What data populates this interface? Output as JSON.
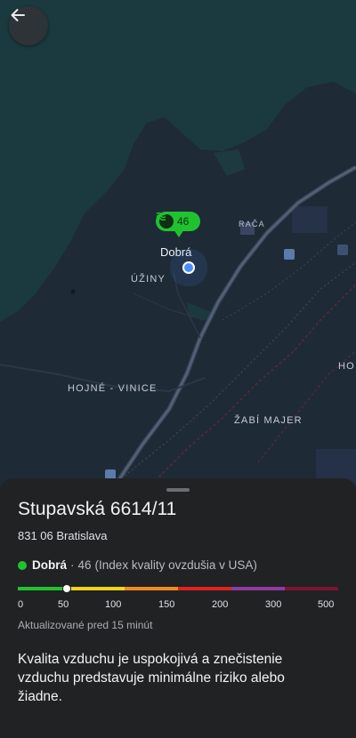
{
  "map": {
    "labels": {
      "uziny": "ÚŽINY",
      "raca": "RAČA",
      "hojne_vinice": "HOJNÉ - VINICE",
      "zabi_majer": "ŽABÍ MAJER",
      "edge": "HO"
    },
    "pin": {
      "value": "46",
      "icon": "air-quality-waves-icon",
      "color": "#1fc32e"
    },
    "pin_label": "Dobrá",
    "current_location_color": "#4a8df8"
  },
  "sheet": {
    "title": "Stupavská 6614/11",
    "subtitle": "831 06 Bratislava",
    "status": {
      "word": "Dobrá",
      "separator": "·",
      "aqi": "46",
      "index_name": "(Index kvality ovzdušia v USA)",
      "color": "#1fc32e"
    },
    "scale": {
      "value": 46,
      "ticks": [
        "0",
        "50",
        "100",
        "150",
        "200",
        "300",
        "500"
      ],
      "segment_colors": [
        "#1fc32e",
        "#f2d31b",
        "#f28a1e",
        "#e0231d",
        "#8e3aa0",
        "#7a1530"
      ]
    },
    "updated": "Aktualizované pred 15 minút",
    "description": "Kvalita vzduchu je uspokojivá a znečistenie vzduchu predstavuje minimálne riziko alebo žiadne."
  }
}
